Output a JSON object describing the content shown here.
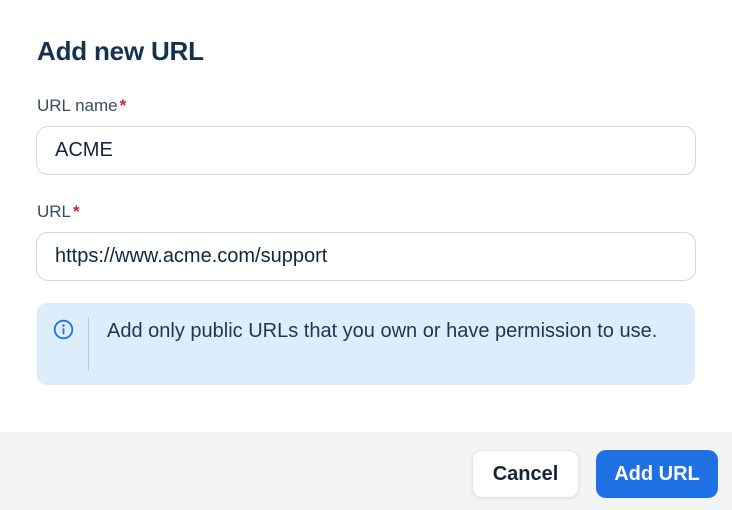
{
  "dialog": {
    "title": "Add new URL"
  },
  "form": {
    "url_name": {
      "label": "URL name",
      "required_mark": "*",
      "value": "ACME"
    },
    "url": {
      "label": "URL",
      "required_mark": "*",
      "value": "https://www.acme.com/support"
    }
  },
  "notice": {
    "icon": "info-icon",
    "text": "Add only public URLs that you own or have permission to use."
  },
  "footer": {
    "cancel_label": "Cancel",
    "submit_label": "Add URL"
  },
  "colors": {
    "primary": "#1f6fe5",
    "required": "#d11f2e",
    "notice_bg": "#dcedfb",
    "footer_bg": "#f3f4f6"
  }
}
